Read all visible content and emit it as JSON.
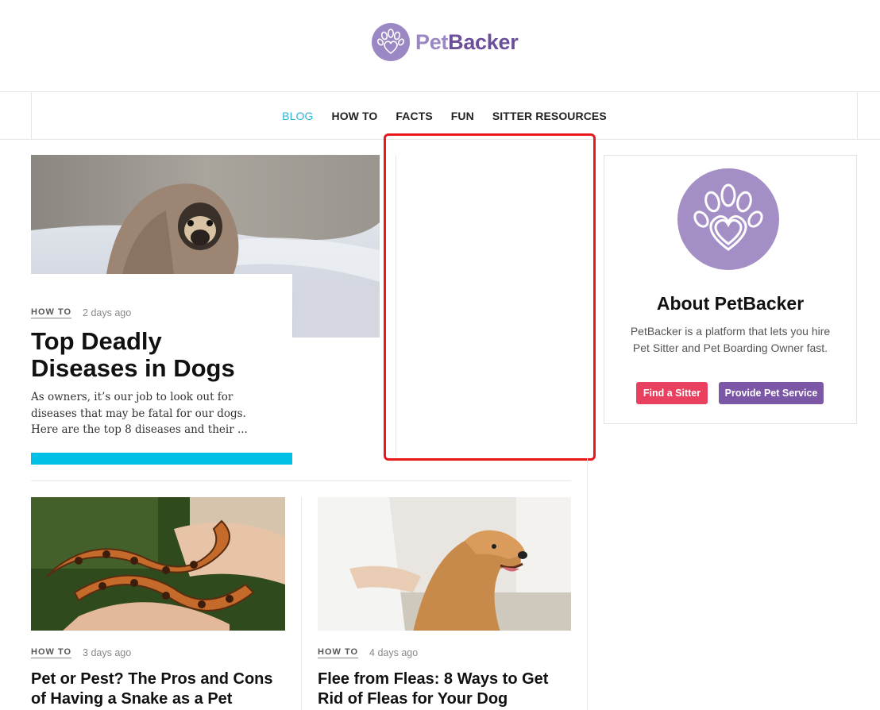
{
  "header": {
    "logo_pet": "Pet",
    "logo_backer": "Backer"
  },
  "nav": {
    "items": [
      {
        "label": "BLOG",
        "active": true
      },
      {
        "label": "HOW TO",
        "active": false
      },
      {
        "label": "FACTS",
        "active": false
      },
      {
        "label": "FUN",
        "active": false
      },
      {
        "label": "SITTER RESOURCES",
        "active": false
      }
    ]
  },
  "featured": {
    "category": "HOW TO",
    "date": "2 days ago",
    "title": "Top Deadly Diseases in Dogs",
    "excerpt": "As owners, it’s our job to look out for diseases that may be fatal for our dogs. Here are the top 8 diseases and their ...",
    "image": "pug-in-blanket-photo"
  },
  "sidebar": {
    "about_title": "About PetBacker",
    "about_text": "PetBacker is a platform that lets you hire Pet Sitter and Pet Boarding Owner fast.",
    "find_sitter_label": "Find a Sitter",
    "provide_service_label": "Provide Pet Service"
  },
  "cards": [
    {
      "category": "HOW TO",
      "date": "3 days ago",
      "title": "Pet or Pest? The Pros and Cons of Having a Snake as a Pet",
      "image": "snake-in-hands-photo"
    },
    {
      "category": "HOW TO",
      "date": "4 days ago",
      "title": "Flee from Fleas: 8 Ways to Get Rid of Fleas for Your Dog",
      "image": "golden-retriever-bath-photo"
    }
  ],
  "colors": {
    "accent": "#2bb5d8",
    "feature_bar": "#00c0e6",
    "brand_light": "#9b87c4",
    "brand_dark": "#6b4f9a",
    "button_red": "#e8405e",
    "button_purple": "#7b57a6",
    "highlight": "#e8191c"
  }
}
